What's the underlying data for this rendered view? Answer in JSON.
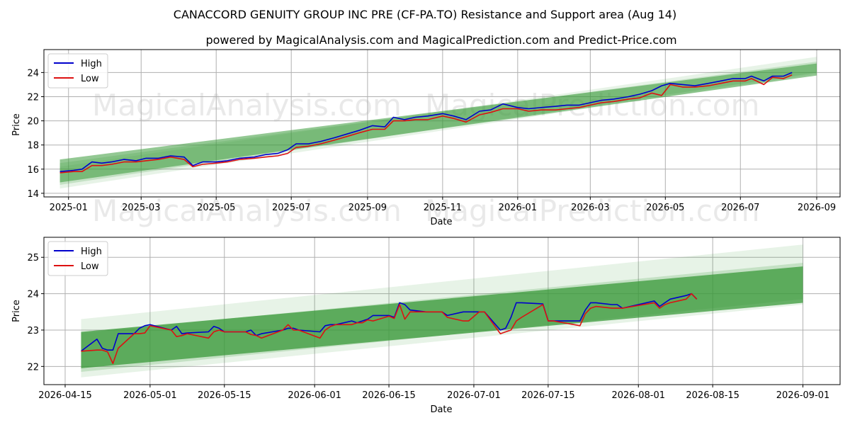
{
  "title": "CANACCORD GENUITY GROUP INC PRE (CF-PA.TO) Resistance and Support area (Aug 14)",
  "subtitle": "powered by MagicalAnalysis.com and MagicalPrediction.com and Predict-Price.com",
  "watermarks": [
    "MagicalAnalysis.com",
    "MagicalPrediction.com"
  ],
  "colors": {
    "high": "#0000cc",
    "low": "#dd1111",
    "band": "#3a9a3a",
    "grid": "#b0b0b0"
  },
  "chart_data": [
    {
      "type": "line",
      "xlabel": "Date",
      "ylabel": "Price",
      "xlim": [
        "2024-12-12",
        "2026-09-20"
      ],
      "ylim": [
        13.7,
        25.9
      ],
      "grid": true,
      "legend": "top-left",
      "xticks": [
        "2025-01",
        "2025-03",
        "2025-05",
        "2025-07",
        "2025-09",
        "2025-11",
        "2026-01",
        "2026-03",
        "2026-05",
        "2026-07",
        "2026-09"
      ],
      "yticks": [
        14,
        16,
        18,
        20,
        22,
        24
      ],
      "bands": [
        {
          "x": [
            "2024-12-25",
            "2026-09-01"
          ],
          "upper": [
            16.8,
            24.75
          ],
          "lower": [
            14.9,
            23.75
          ],
          "opacity": 0.55
        },
        {
          "x": [
            "2024-12-25",
            "2026-09-01"
          ],
          "upper": [
            16.5,
            24.9
          ],
          "lower": [
            14.7,
            24.0
          ],
          "opacity": 0.2
        },
        {
          "x": [
            "2024-12-25",
            "2026-09-01"
          ],
          "upper": [
            16.2,
            25.3
          ],
          "lower": [
            14.4,
            23.9
          ],
          "opacity": 0.12
        }
      ],
      "series": [
        {
          "name": "High",
          "x": [
            "2024-12-25",
            "2025-01-05",
            "2025-01-12",
            "2025-01-20",
            "2025-01-28",
            "2025-02-05",
            "2025-02-15",
            "2025-02-25",
            "2025-03-05",
            "2025-03-15",
            "2025-03-25",
            "2025-04-05",
            "2025-04-12",
            "2025-04-20",
            "2025-05-01",
            "2025-05-10",
            "2025-05-20",
            "2025-06-01",
            "2025-06-10",
            "2025-06-20",
            "2025-06-28",
            "2025-07-05",
            "2025-07-15",
            "2025-07-25",
            "2025-08-05",
            "2025-08-15",
            "2025-08-25",
            "2025-09-05",
            "2025-09-15",
            "2025-09-22",
            "2025-10-01",
            "2025-10-10",
            "2025-10-20",
            "2025-11-01",
            "2025-11-10",
            "2025-11-20",
            "2025-12-01",
            "2025-12-10",
            "2025-12-20",
            "2026-01-01",
            "2026-01-10",
            "2026-01-20",
            "2026-02-01",
            "2026-02-10",
            "2026-02-20",
            "2026-03-01",
            "2026-03-10",
            "2026-03-20",
            "2026-04-01",
            "2026-04-10",
            "2026-04-20",
            "2026-04-28",
            "2026-05-05",
            "2026-05-15",
            "2026-05-25",
            "2026-06-05",
            "2026-06-15",
            "2026-06-25",
            "2026-07-05",
            "2026-07-10",
            "2026-07-20",
            "2026-07-27",
            "2026-08-05",
            "2026-08-12"
          ],
          "y": [
            15.8,
            15.9,
            16.0,
            16.6,
            16.5,
            16.6,
            16.8,
            16.7,
            16.9,
            16.9,
            17.1,
            17.0,
            16.3,
            16.6,
            16.6,
            16.7,
            16.9,
            17.0,
            17.2,
            17.3,
            17.6,
            18.1,
            18.1,
            18.3,
            18.6,
            18.9,
            19.2,
            19.6,
            19.5,
            20.3,
            20.1,
            20.3,
            20.4,
            20.6,
            20.4,
            20.1,
            20.8,
            20.9,
            21.4,
            21.1,
            21.0,
            21.1,
            21.2,
            21.3,
            21.3,
            21.5,
            21.7,
            21.8,
            22.0,
            22.2,
            22.5,
            22.9,
            23.1,
            23.0,
            22.9,
            23.1,
            23.3,
            23.5,
            23.5,
            23.7,
            23.3,
            23.7,
            23.7,
            24.0
          ]
        },
        {
          "name": "Low",
          "x": [
            "2024-12-25",
            "2025-01-05",
            "2025-01-12",
            "2025-01-20",
            "2025-01-28",
            "2025-02-05",
            "2025-02-15",
            "2025-02-25",
            "2025-03-05",
            "2025-03-15",
            "2025-03-25",
            "2025-04-05",
            "2025-04-12",
            "2025-04-20",
            "2025-05-01",
            "2025-05-10",
            "2025-05-20",
            "2025-06-01",
            "2025-06-10",
            "2025-06-20",
            "2025-06-28",
            "2025-07-05",
            "2025-07-15",
            "2025-07-25",
            "2025-08-05",
            "2025-08-15",
            "2025-08-25",
            "2025-09-05",
            "2025-09-15",
            "2025-09-22",
            "2025-10-01",
            "2025-10-10",
            "2025-10-20",
            "2025-11-01",
            "2025-11-10",
            "2025-11-20",
            "2025-12-01",
            "2025-12-10",
            "2025-12-20",
            "2026-01-01",
            "2026-01-10",
            "2026-01-20",
            "2026-02-01",
            "2026-02-10",
            "2026-02-20",
            "2026-03-01",
            "2026-03-10",
            "2026-03-20",
            "2026-04-01",
            "2026-04-10",
            "2026-04-20",
            "2026-04-28",
            "2026-05-05",
            "2026-05-15",
            "2026-05-25",
            "2026-06-05",
            "2026-06-15",
            "2026-06-25",
            "2026-07-05",
            "2026-07-10",
            "2026-07-20",
            "2026-07-27",
            "2026-08-05",
            "2026-08-12"
          ],
          "y": [
            15.7,
            15.8,
            15.8,
            16.3,
            16.3,
            16.4,
            16.6,
            16.6,
            16.7,
            16.8,
            17.0,
            16.8,
            16.2,
            16.4,
            16.5,
            16.6,
            16.8,
            16.9,
            17.0,
            17.1,
            17.3,
            17.8,
            17.9,
            18.1,
            18.4,
            18.7,
            19.0,
            19.3,
            19.3,
            20.0,
            20.0,
            20.1,
            20.1,
            20.4,
            20.2,
            19.9,
            20.5,
            20.7,
            21.0,
            21.0,
            20.8,
            20.9,
            20.9,
            21.0,
            21.1,
            21.3,
            21.5,
            21.6,
            21.8,
            21.9,
            22.3,
            22.1,
            23.0,
            22.8,
            22.8,
            22.9,
            23.1,
            23.3,
            23.3,
            23.5,
            23.0,
            23.6,
            23.5,
            23.8
          ]
        }
      ]
    },
    {
      "type": "line",
      "xlabel": "Date",
      "ylabel": "Price",
      "xlim": [
        "2026-04-11",
        "2026-09-08"
      ],
      "ylim": [
        21.5,
        25.55
      ],
      "grid": true,
      "legend": "top-left",
      "xticks": [
        "2026-04-15",
        "2026-05-01",
        "2026-05-15",
        "2026-06-01",
        "2026-06-15",
        "2026-07-01",
        "2026-07-15",
        "2026-08-01",
        "2026-08-15",
        "2026-09-01"
      ],
      "yticks": [
        22,
        23,
        24,
        25
      ],
      "bands": [
        {
          "x": [
            "2026-04-18",
            "2026-09-01"
          ],
          "upper": [
            22.95,
            24.75
          ],
          "lower": [
            21.95,
            23.75
          ],
          "opacity": 0.75
        },
        {
          "x": [
            "2026-04-18",
            "2026-09-01"
          ],
          "upper": [
            22.92,
            24.85
          ],
          "lower": [
            21.85,
            23.85
          ],
          "opacity": 0.2
        },
        {
          "x": [
            "2026-04-18",
            "2026-09-01"
          ],
          "upper": [
            23.3,
            25.35
          ],
          "lower": [
            21.7,
            23.7
          ],
          "opacity": 0.12
        }
      ],
      "series": [
        {
          "name": "High",
          "x": [
            "2026-04-18",
            "2026-04-21",
            "2026-04-22",
            "2026-04-23",
            "2026-04-24",
            "2026-04-25",
            "2026-04-28",
            "2026-04-29",
            "2026-04-30",
            "2026-05-01",
            "2026-05-05",
            "2026-05-06",
            "2026-05-07",
            "2026-05-08",
            "2026-05-12",
            "2026-05-13",
            "2026-05-14",
            "2026-05-15",
            "2026-05-19",
            "2026-05-20",
            "2026-05-21",
            "2026-05-22",
            "2026-05-26",
            "2026-05-27",
            "2026-05-28",
            "2026-05-29",
            "2026-06-02",
            "2026-06-03",
            "2026-06-04",
            "2026-06-05",
            "2026-06-08",
            "2026-06-09",
            "2026-06-10",
            "2026-06-11",
            "2026-06-12",
            "2026-06-15",
            "2026-06-16",
            "2026-06-17",
            "2026-06-18",
            "2026-06-19",
            "2026-06-22",
            "2026-06-23",
            "2026-06-24",
            "2026-06-25",
            "2026-06-26",
            "2026-06-29",
            "2026-06-30",
            "2026-07-02",
            "2026-07-03",
            "2026-07-06",
            "2026-07-07",
            "2026-07-08",
            "2026-07-09",
            "2026-07-10",
            "2026-07-14",
            "2026-07-15",
            "2026-07-16",
            "2026-07-21",
            "2026-07-22",
            "2026-07-23",
            "2026-07-24",
            "2026-07-27",
            "2026-07-28",
            "2026-07-29",
            "2026-08-04",
            "2026-08-05",
            "2026-08-06",
            "2026-08-07",
            "2026-08-10",
            "2026-08-11",
            "2026-08-12"
          ],
          "y": [
            22.42,
            22.75,
            22.5,
            22.45,
            22.45,
            22.9,
            22.9,
            23.05,
            23.12,
            23.15,
            23.0,
            23.1,
            22.9,
            22.92,
            22.95,
            23.1,
            23.05,
            22.95,
            22.95,
            23.0,
            22.85,
            22.9,
            23.0,
            23.05,
            23.05,
            23.0,
            22.95,
            23.12,
            23.15,
            23.15,
            23.25,
            23.2,
            23.25,
            23.3,
            23.4,
            23.4,
            23.35,
            23.75,
            23.7,
            23.55,
            23.5,
            23.5,
            23.5,
            23.5,
            23.4,
            23.5,
            23.5,
            23.5,
            23.5,
            23.0,
            23.05,
            23.35,
            23.75,
            23.75,
            23.72,
            23.25,
            23.25,
            23.25,
            23.55,
            23.75,
            23.75,
            23.7,
            23.7,
            23.6,
            23.8,
            23.65,
            23.75,
            23.85,
            23.95,
            24.0,
            23.85
          ]
        },
        {
          "name": "Low",
          "x": [
            "2026-04-18",
            "2026-04-21",
            "2026-04-22",
            "2026-04-23",
            "2026-04-24",
            "2026-04-25",
            "2026-04-28",
            "2026-04-29",
            "2026-04-30",
            "2026-05-01",
            "2026-05-05",
            "2026-05-06",
            "2026-05-07",
            "2026-05-08",
            "2026-05-12",
            "2026-05-13",
            "2026-05-14",
            "2026-05-15",
            "2026-05-19",
            "2026-05-20",
            "2026-05-21",
            "2026-05-22",
            "2026-05-26",
            "2026-05-27",
            "2026-05-28",
            "2026-05-29",
            "2026-06-02",
            "2026-06-03",
            "2026-06-04",
            "2026-06-05",
            "2026-06-08",
            "2026-06-09",
            "2026-06-10",
            "2026-06-11",
            "2026-06-12",
            "2026-06-15",
            "2026-06-16",
            "2026-06-17",
            "2026-06-18",
            "2026-06-19",
            "2026-06-22",
            "2026-06-23",
            "2026-06-24",
            "2026-06-25",
            "2026-06-26",
            "2026-06-29",
            "2026-06-30",
            "2026-07-02",
            "2026-07-03",
            "2026-07-06",
            "2026-07-07",
            "2026-07-08",
            "2026-07-09",
            "2026-07-10",
            "2026-07-14",
            "2026-07-15",
            "2026-07-16",
            "2026-07-21",
            "2026-07-22",
            "2026-07-23",
            "2026-07-24",
            "2026-07-27",
            "2026-07-28",
            "2026-07-29",
            "2026-08-04",
            "2026-08-05",
            "2026-08-06",
            "2026-08-07",
            "2026-08-10",
            "2026-08-11",
            "2026-08-12"
          ],
          "y": [
            22.42,
            22.45,
            22.45,
            22.4,
            22.08,
            22.5,
            22.9,
            22.9,
            22.92,
            23.12,
            23.0,
            22.82,
            22.85,
            22.9,
            22.78,
            22.95,
            23.0,
            22.95,
            22.95,
            22.88,
            22.85,
            22.78,
            23.0,
            23.15,
            23.0,
            23.0,
            22.78,
            23.0,
            23.1,
            23.15,
            23.15,
            23.2,
            23.2,
            23.28,
            23.25,
            23.38,
            23.32,
            23.7,
            23.3,
            23.5,
            23.5,
            23.5,
            23.5,
            23.5,
            23.35,
            23.25,
            23.25,
            23.5,
            23.5,
            22.9,
            22.95,
            23.0,
            23.25,
            23.35,
            23.7,
            23.25,
            23.25,
            23.12,
            23.45,
            23.6,
            23.65,
            23.6,
            23.6,
            23.6,
            23.75,
            23.6,
            23.7,
            23.75,
            23.85,
            24.0,
            23.85
          ]
        }
      ]
    }
  ]
}
